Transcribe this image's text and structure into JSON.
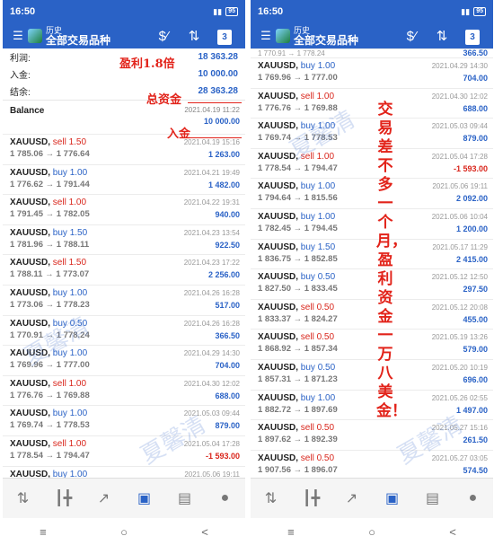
{
  "left": {
    "status": {
      "time": "16:50",
      "battery": "95"
    },
    "appbar": {
      "subtitle": "历史",
      "title": "全部交易品种",
      "calendar_day": "3"
    },
    "summary": [
      {
        "label": "利润:",
        "value": "18 363.28"
      },
      {
        "label": "入金:",
        "value": "10 000.00"
      },
      {
        "label": "结余:",
        "value": "28 363.28"
      }
    ],
    "balance": {
      "label": "Balance",
      "date": "2021.04.19 11:22",
      "amount": "10 000.00"
    },
    "trades": [
      {
        "symbol": "XAUUSD,",
        "side": "sell",
        "lots": "1.50",
        "prices": "1 785.06 → 1 776.64",
        "date": "2021.04.19 15:16",
        "profit": "1 263.00",
        "neg": false
      },
      {
        "symbol": "XAUUSD,",
        "side": "buy",
        "lots": "1.00",
        "prices": "1 776.62 → 1 791.44",
        "date": "2021.04.21 19:49",
        "profit": "1 482.00",
        "neg": false
      },
      {
        "symbol": "XAUUSD,",
        "side": "sell",
        "lots": "1.00",
        "prices": "1 791.45 → 1 782.05",
        "date": "2021.04.22 19:31",
        "profit": "940.00",
        "neg": false
      },
      {
        "symbol": "XAUUSD,",
        "side": "buy",
        "lots": "1.50",
        "prices": "1 781.96 → 1 788.11",
        "date": "2021.04.23 13:54",
        "profit": "922.50",
        "neg": false
      },
      {
        "symbol": "XAUUSD,",
        "side": "sell",
        "lots": "1.50",
        "prices": "1 788.11 → 1 773.07",
        "date": "2021.04.23 17:22",
        "profit": "2 256.00",
        "neg": false
      },
      {
        "symbol": "XAUUSD,",
        "side": "buy",
        "lots": "1.00",
        "prices": "1 773.06 → 1 778.23",
        "date": "2021.04.26 16:28",
        "profit": "517.00",
        "neg": false
      },
      {
        "symbol": "XAUUSD,",
        "side": "buy",
        "lots": "0.50",
        "prices": "1 770.91 → 1 778.24",
        "date": "2021.04.26 16:28",
        "profit": "366.50",
        "neg": false
      },
      {
        "symbol": "XAUUSD,",
        "side": "buy",
        "lots": "1.00",
        "prices": "1 769.96 → 1 777.00",
        "date": "2021.04.29 14:30",
        "profit": "704.00",
        "neg": false
      },
      {
        "symbol": "XAUUSD,",
        "side": "sell",
        "lots": "1.00",
        "prices": "1 776.76 → 1 769.88",
        "date": "2021.04.30 12:02",
        "profit": "688.00",
        "neg": false
      },
      {
        "symbol": "XAUUSD,",
        "side": "buy",
        "lots": "1.00",
        "prices": "1 769.74 → 1 778.53",
        "date": "2021.05.03 09:44",
        "profit": "879.00",
        "neg": false
      },
      {
        "symbol": "XAUUSD,",
        "side": "sell",
        "lots": "1.00",
        "prices": "1 778.54 → 1 794.47",
        "date": "2021.05.04 17:28",
        "profit": "-1 593.00",
        "neg": true
      },
      {
        "symbol": "XAUUSD,",
        "side": "buy",
        "lots": "1.00",
        "prices": "",
        "date": "2021.05.06 19:11",
        "profit": "",
        "neg": false
      }
    ],
    "annotations": {
      "profit_note": "盈利1.8倍",
      "deposit_note": "入金",
      "total_note": "总资金"
    }
  },
  "right": {
    "status": {
      "time": "16:50",
      "battery": "95"
    },
    "appbar": {
      "subtitle": "历史",
      "title": "全部交易品种",
      "calendar_day": "3"
    },
    "top_partial": {
      "prices": "1 770.91 → 1 778.24",
      "profit": "366.50"
    },
    "trades": [
      {
        "symbol": "XAUUSD,",
        "side": "buy",
        "lots": "1.00",
        "prices": "1 769.96 → 1 777.00",
        "date": "2021.04.29 14:30",
        "profit": "704.00",
        "neg": false
      },
      {
        "symbol": "XAUUSD,",
        "side": "sell",
        "lots": "1.00",
        "prices": "1 776.76 → 1 769.88",
        "date": "2021.04.30 12:02",
        "profit": "688.00",
        "neg": false
      },
      {
        "symbol": "XAUUSD,",
        "side": "buy",
        "lots": "1.00",
        "prices": "1 769.74 → 1 778.53",
        "date": "2021.05.03 09:44",
        "profit": "879.00",
        "neg": false
      },
      {
        "symbol": "XAUUSD,",
        "side": "sell",
        "lots": "1.00",
        "prices": "1 778.54 → 1 794.47",
        "date": "2021.05.04 17:28",
        "profit": "-1 593.00",
        "neg": true
      },
      {
        "symbol": "XAUUSD,",
        "side": "buy",
        "lots": "1.00",
        "prices": "1 794.64 → 1 815.56",
        "date": "2021.05.06 19:11",
        "profit": "2 092.00",
        "neg": false
      },
      {
        "symbol": "XAUUSD,",
        "side": "buy",
        "lots": "1.00",
        "prices": "1 782.45 → 1 794.45",
        "date": "2021.05.06 10:04",
        "profit": "1 200.00",
        "neg": false
      },
      {
        "symbol": "XAUUSD,",
        "side": "buy",
        "lots": "1.50",
        "prices": "1 836.75 → 1 852.85",
        "date": "2021.05.17 11:29",
        "profit": "2 415.00",
        "neg": false
      },
      {
        "symbol": "XAUUSD,",
        "side": "buy",
        "lots": "0.50",
        "prices": "1 827.50 → 1 833.45",
        "date": "2021.05.12 12:50",
        "profit": "297.50",
        "neg": false
      },
      {
        "symbol": "XAUUSD,",
        "side": "sell",
        "lots": "0.50",
        "prices": "1 833.37 → 1 824.27",
        "date": "2021.05.12 20:08",
        "profit": "455.00",
        "neg": false
      },
      {
        "symbol": "XAUUSD,",
        "side": "sell",
        "lots": "0.50",
        "prices": "1 868.92 → 1 857.34",
        "date": "2021.05.19 13:26",
        "profit": "579.00",
        "neg": false
      },
      {
        "symbol": "XAUUSD,",
        "side": "buy",
        "lots": "0.50",
        "prices": "1 857.31 → 1 871.23",
        "date": "2021.05.20 10:19",
        "profit": "696.00",
        "neg": false
      },
      {
        "symbol": "XAUUSD,",
        "side": "buy",
        "lots": "1.00",
        "prices": "1 882.72 → 1 897.69",
        "date": "2021.05.26 02:55",
        "profit": "1 497.00",
        "neg": false
      },
      {
        "symbol": "XAUUSD,",
        "side": "sell",
        "lots": "0.50",
        "prices": "1 897.62 → 1 892.39",
        "date": "2021.05.27 15:16",
        "profit": "261.50",
        "neg": false
      },
      {
        "symbol": "XAUUSD,",
        "side": "sell",
        "lots": "0.50",
        "prices": "1 907.56 → 1 896.07",
        "date": "2021.05.27 03:05",
        "profit": "574.50",
        "neg": false
      }
    ],
    "annotations": {
      "vertical_note": "交易差不多一个月，盈利资金一万八美金！"
    }
  },
  "watermark": "夏馨清",
  "nav": {
    "recent": "≡",
    "home": "○",
    "back": "<"
  }
}
